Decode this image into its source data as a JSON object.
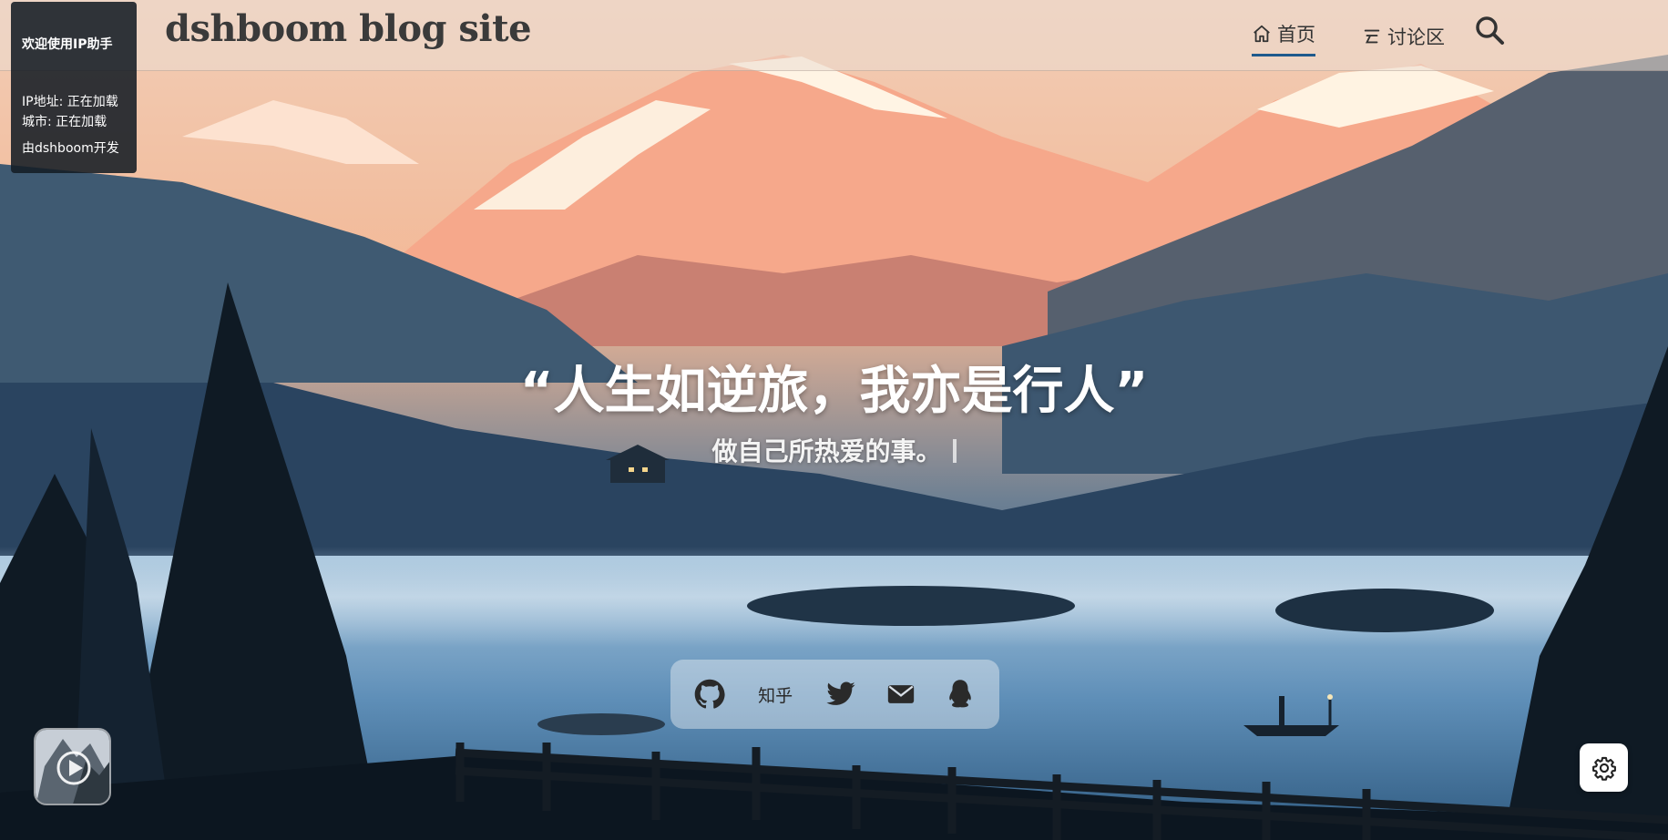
{
  "site": {
    "title": "dshboom blog site"
  },
  "nav": {
    "home_label": "首页",
    "forum_label": "讨论区",
    "home_icon": "home-icon",
    "forum_icon": "forum-icon",
    "search_icon": "search-icon",
    "active_underline_color": "#1e5a8c"
  },
  "ip_panel": {
    "title": "欢迎使用IP助手",
    "ip_line": "IP地址: 正在加载",
    "city_line": "城市: 正在加载",
    "credit": "由dshboom开发"
  },
  "hero": {
    "quote": "“人生如逆旅，我亦是行人”",
    "subtitle": "做自己所热爱的事。"
  },
  "social": {
    "github_icon": "github-icon",
    "zhihu_label": "知乎",
    "twitter_icon": "twitter-icon",
    "mail_icon": "mail-icon",
    "qq_icon": "qq-icon"
  },
  "widgets": {
    "music_icon": "play-icon",
    "settings_icon": "gear-icon"
  }
}
